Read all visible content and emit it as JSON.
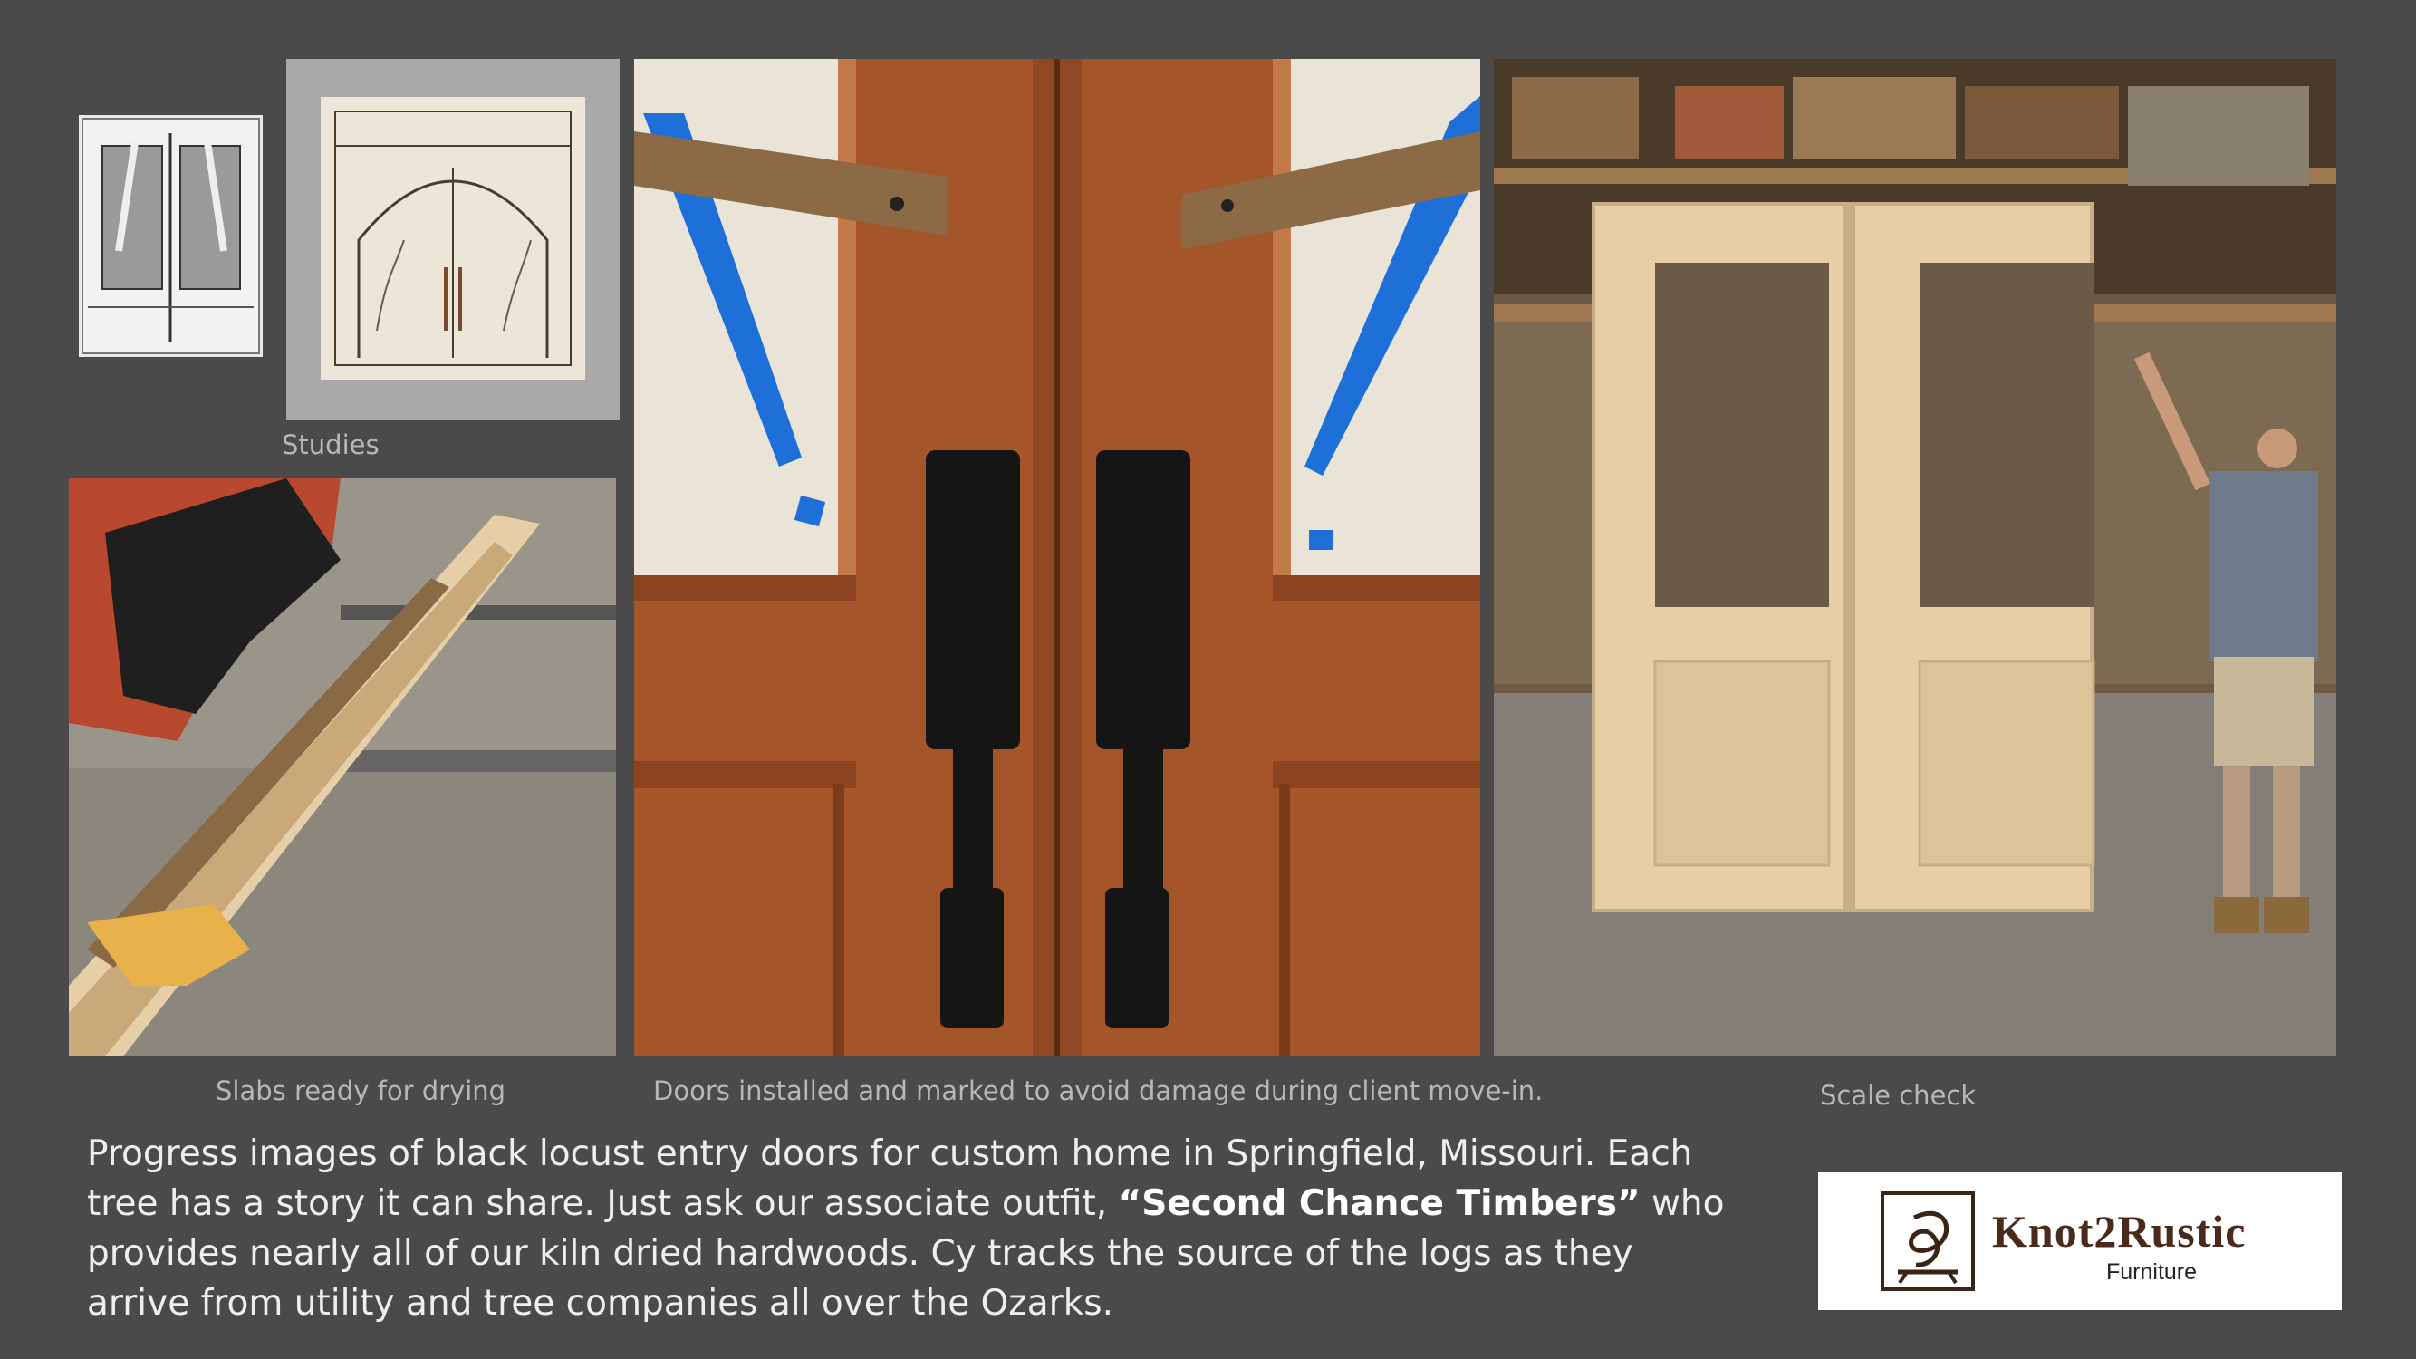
{
  "captions": {
    "studies": "Studies",
    "slabs": "Slabs ready for drying",
    "doors": "Doors installed and marked to avoid damage during client move-in.",
    "scale": "Scale check"
  },
  "description": {
    "part1": "Progress images of black locust entry doors for custom home in Springfield, Missouri.  Each tree has a story it can share.   Just ask our associate outfit, ",
    "highlight": "“Second Chance Timbers”",
    "part2": " who provides nearly all of our kiln dried hardwoods.  Cy tracks the source  of the logs as they arrive from utility and tree companies all over the Ozarks."
  },
  "logo": {
    "name": "Knot2Rustic",
    "subtitle": "Furniture"
  },
  "colors": {
    "background": "#4a4a4a",
    "caption": "#b7b7b7",
    "body_text": "#eeeeee",
    "door_wood": "#a5552a",
    "raw_wood": "#e6cfa6",
    "painters_tape": "#1e6fd8",
    "logo_brown": "#4a2a1a"
  }
}
